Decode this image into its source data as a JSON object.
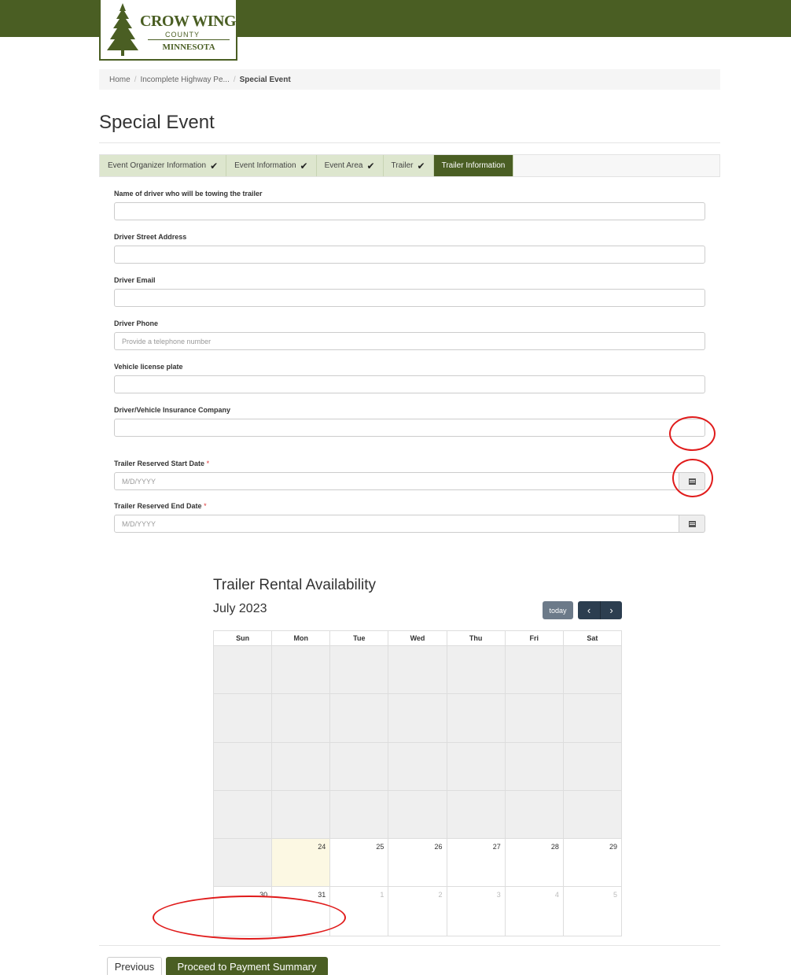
{
  "logo": {
    "line1": "CROW WING",
    "line2": "COUNTY",
    "line3": "MINNESOTA"
  },
  "breadcrumb": {
    "items": [
      "Home",
      "Incomplete Highway Pe...",
      "Special Event"
    ]
  },
  "page_title": "Special Event",
  "tabs": [
    {
      "label": "Event Organizer Information",
      "done": true
    },
    {
      "label": "Event Information",
      "done": true
    },
    {
      "label": "Event Area",
      "done": true
    },
    {
      "label": "Trailer",
      "done": true
    },
    {
      "label": "Trailer Information",
      "done": false
    }
  ],
  "form": {
    "driver_name_label": "Name of driver who will be towing the trailer",
    "driver_address_label": "Driver Street Address",
    "driver_email_label": "Driver Email",
    "driver_phone_label": "Driver Phone",
    "driver_phone_placeholder": "Provide a telephone number",
    "plate_label": "Vehicle license plate",
    "insurance_label": "Driver/Vehicle Insurance Company",
    "start_date_label": "Trailer Reserved Start Date",
    "start_date_placeholder": "M/D/YYYY",
    "end_date_label": "Trailer Reserved End Date",
    "end_date_placeholder": "M/D/YYYY",
    "required_mark": "*"
  },
  "calendar": {
    "title": "Trailer Rental Availability",
    "month": "July 2023",
    "today_label": "today",
    "prev_icon": "chevron-left-icon",
    "next_icon": "chevron-right-icon",
    "weekdays": [
      "Sun",
      "Mon",
      "Tue",
      "Wed",
      "Thu",
      "Fri",
      "Sat"
    ],
    "week5": [
      "",
      "24",
      "25",
      "26",
      "27",
      "28",
      "29"
    ],
    "week6": [
      "30",
      "31",
      "1",
      "2",
      "3",
      "4",
      "5"
    ]
  },
  "footer": {
    "previous_label": "Previous",
    "proceed_label": "Proceed to Payment Summary"
  },
  "colors": {
    "brand_green": "#4a5e23",
    "tab_done_bg": "#dde6ce",
    "nav_dark": "#2c3e50",
    "annotation_red": "#e01b1b"
  }
}
